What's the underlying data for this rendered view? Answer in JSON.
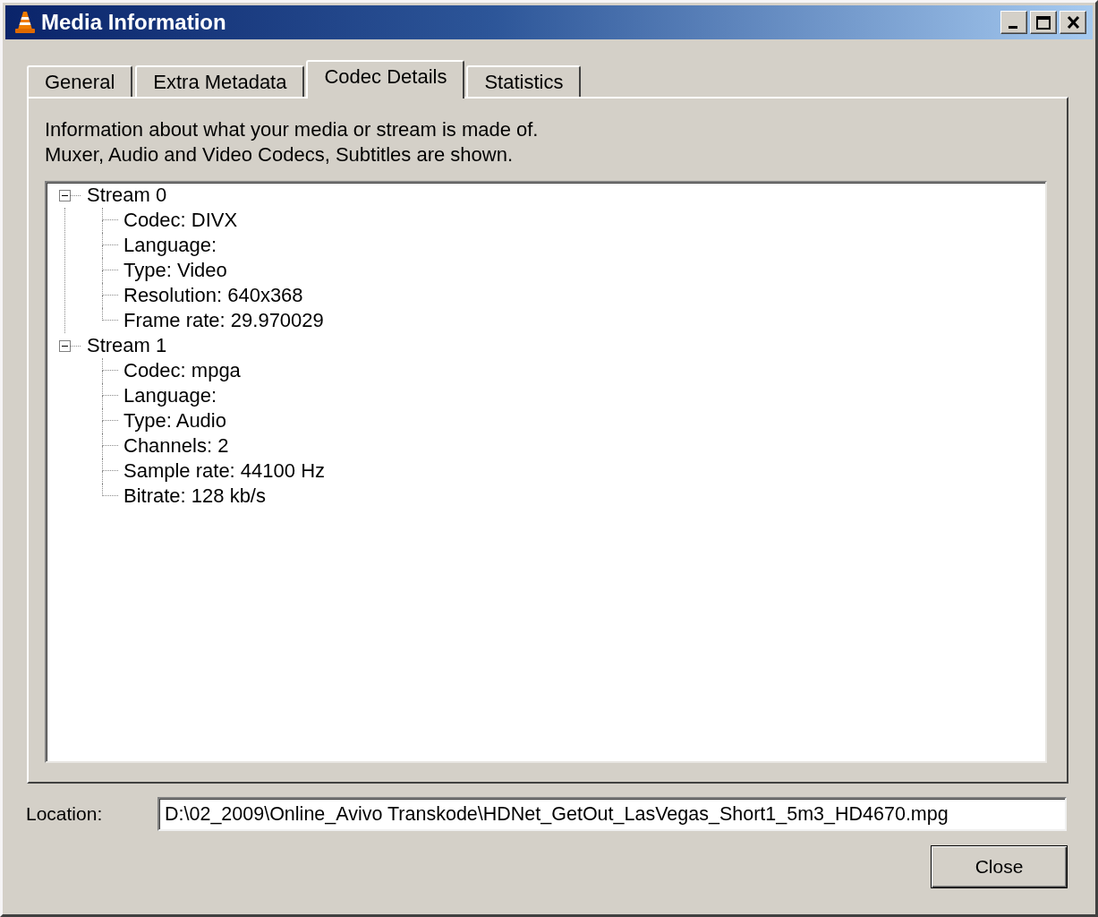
{
  "window": {
    "title": "Media Information"
  },
  "tabs": [
    {
      "label": "General",
      "selected": false
    },
    {
      "label": "Extra Metadata",
      "selected": false
    },
    {
      "label": "Codec Details",
      "selected": true
    },
    {
      "label": "Statistics",
      "selected": false
    }
  ],
  "description": [
    "Information about what your media or stream is made of.",
    "Muxer, Audio and Video Codecs, Subtitles are shown."
  ],
  "tree": [
    {
      "label": "Stream 0",
      "expanded": true,
      "children": [
        {
          "label": "Codec: DIVX"
        },
        {
          "label": "Language:"
        },
        {
          "label": "Type: Video"
        },
        {
          "label": "Resolution: 640x368"
        },
        {
          "label": "Frame rate: 29.970029"
        }
      ]
    },
    {
      "label": "Stream 1",
      "expanded": true,
      "children": [
        {
          "label": "Codec: mpga"
        },
        {
          "label": "Language:"
        },
        {
          "label": "Type: Audio"
        },
        {
          "label": "Channels: 2"
        },
        {
          "label": "Sample rate: 44100 Hz"
        },
        {
          "label": "Bitrate: 128 kb/s"
        }
      ]
    }
  ],
  "location": {
    "label": "Location:",
    "value": "D:\\02_2009\\Online_Avivo Transkode\\HDNet_GetOut_LasVegas_Short1_5m3_HD4670.mpg"
  },
  "buttons": [
    {
      "label": "Close"
    }
  ]
}
